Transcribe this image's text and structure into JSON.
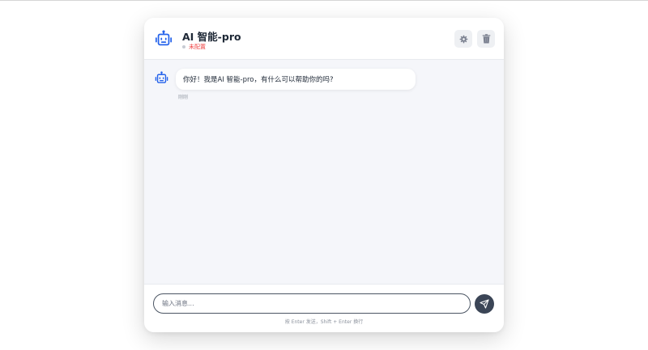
{
  "header": {
    "title": "AI 智能-pro",
    "status": "未配置",
    "avatar_icon": "robot-icon",
    "settings_icon": "gear-icon",
    "clear_icon": "trash-icon"
  },
  "messages": [
    {
      "role": "assistant",
      "avatar_icon": "robot-icon",
      "text": "你好！我是AI 智能-pro，有什么可以帮助你的吗?",
      "time": "刚刚"
    }
  ],
  "input": {
    "value": "",
    "placeholder": "输入消息...",
    "send_icon": "send-icon",
    "hint": "按 Enter 发送，Shift + Enter 换行"
  },
  "colors": {
    "accent": "#2563eb",
    "status_text": "#ef4444",
    "send_button": "#3b4556",
    "chat_background": "#f5f6fa"
  }
}
